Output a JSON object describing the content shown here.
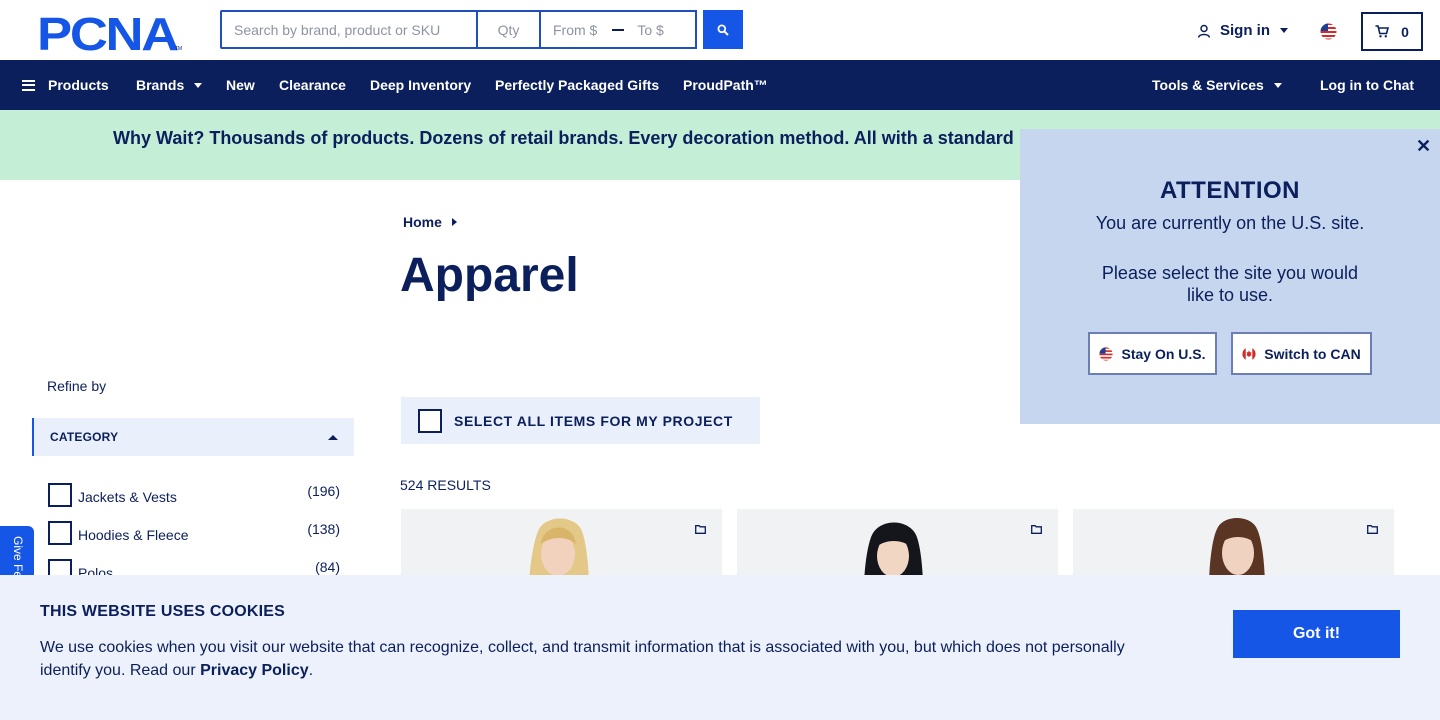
{
  "colors": {
    "navy": "#0b1f5c",
    "accent_blue": "#1556e6",
    "banner_green": "#c4efd6",
    "popup_bg": "#c6d6ef",
    "cookie_bg": "#ecf1fb"
  },
  "header": {
    "logo_text": "PCNA",
    "logo_tm": "TM",
    "search_placeholder": "Search by brand, product or SKU",
    "qty_placeholder": "Qty",
    "price_from_placeholder": "From $",
    "price_to_placeholder": "To $",
    "sign_in_label": "Sign in",
    "cart_count": "0"
  },
  "nav": {
    "products": "Products",
    "brands": "Brands",
    "new": "New",
    "clearance": "Clearance",
    "deep_inventory": "Deep Inventory",
    "perfectly_packaged_gifts": "Perfectly Packaged Gifts",
    "proudpath": "ProudPath™",
    "tools_services": "Tools & Services",
    "log_in_chat": "Log in to Chat"
  },
  "banner": {
    "text": "Why Wait? Thousands of products. Dozens of retail brands. Every decoration method. All with a standard"
  },
  "sidebar": {
    "refine_by": "Refine by",
    "category_heading": "CATEGORY",
    "categories": [
      {
        "name": "Jackets & Vests",
        "count": "(196)"
      },
      {
        "name": "Hoodies & Fleece",
        "count": "(138)"
      },
      {
        "name": "Polos",
        "count": "(84)"
      }
    ],
    "feedback_label": "Give Feedback"
  },
  "main": {
    "breadcrumb_home": "Home",
    "title": "Apparel",
    "select_all_label": "SELECT ALL ITEMS FOR MY PROJECT",
    "results_count": "524 RESULTS"
  },
  "site_popup": {
    "heading": "ATTENTION",
    "line1": "You are currently on the U.S. site.",
    "line2": "Please select the site you would like to use.",
    "stay_button": "Stay On U.S.",
    "switch_button": "Switch to CAN"
  },
  "cookie": {
    "heading": "THIS WEBSITE USES COOKIES",
    "body": "We use cookies when you visit our website that can recognize, collect, and transmit information that is associated with you, but which does not personally identify you. Read our ",
    "link": "Privacy Policy",
    "tail": ".",
    "accept_button": "Got it!"
  }
}
